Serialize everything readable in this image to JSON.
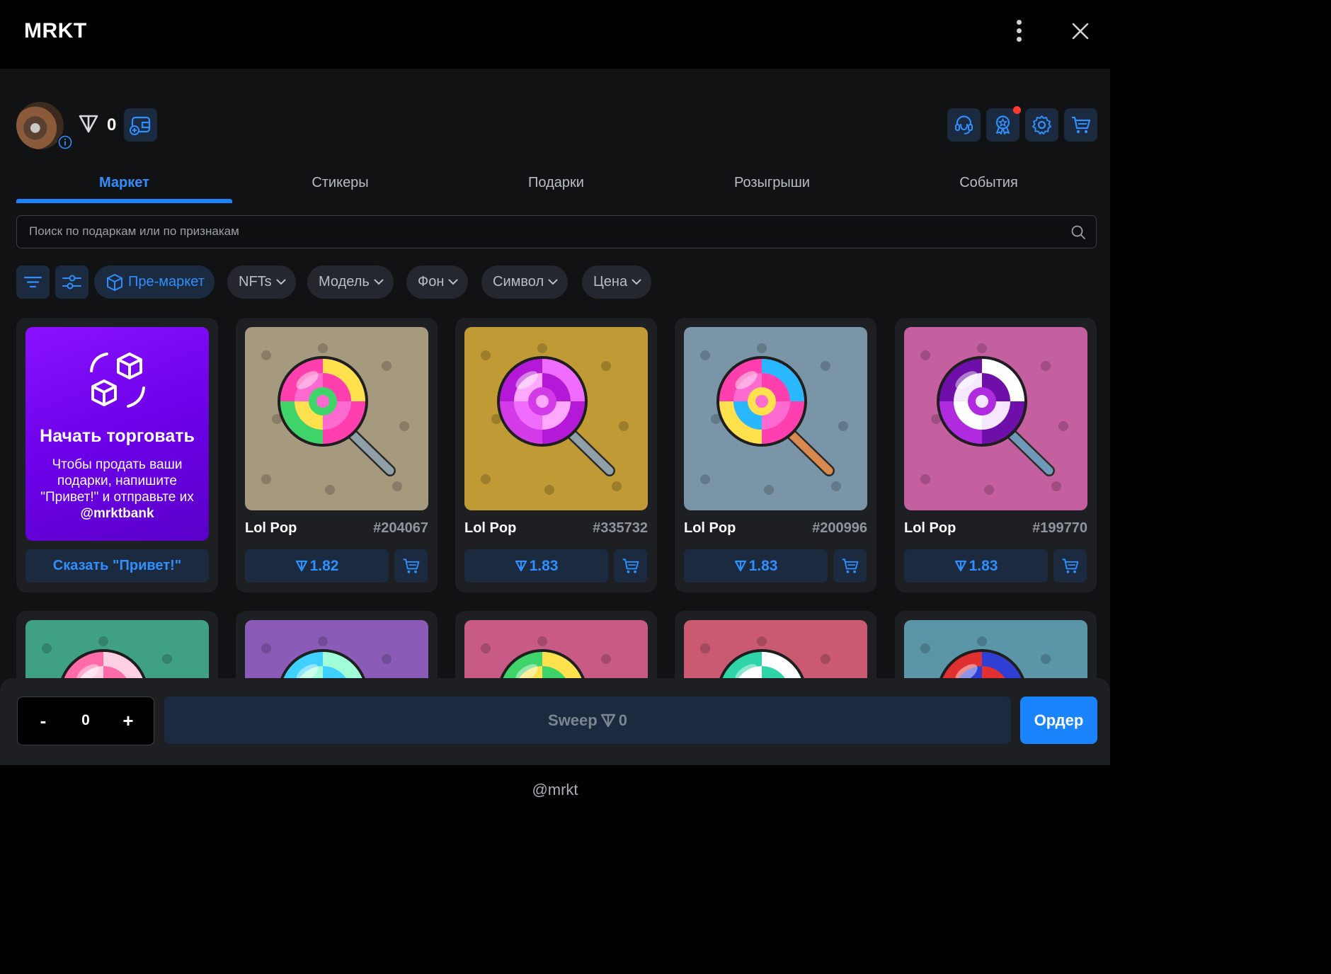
{
  "header": {
    "title": "MRKT",
    "menu_icon": "kebab-icon",
    "close_icon": "close-icon"
  },
  "profile": {
    "balance": "0",
    "currency_icon": "ton-icon"
  },
  "toolbar_icons": [
    "support-icon",
    "rewards-icon",
    "settings-icon",
    "cart-icon"
  ],
  "tabs": [
    {
      "label": "Маркет",
      "active": true
    },
    {
      "label": "Стикеры",
      "active": false
    },
    {
      "label": "Подарки",
      "active": false
    },
    {
      "label": "Розыгрыши",
      "active": false
    },
    {
      "label": "События",
      "active": false
    }
  ],
  "search": {
    "placeholder": "Поиск по подаркам или по признакам",
    "value": ""
  },
  "filters": {
    "premarket": "Пре-маркет",
    "nfts": "NFTs",
    "model": "Модель",
    "background": "Фон",
    "symbol": "Символ",
    "price": "Цена"
  },
  "promo": {
    "title": "Начать торговать",
    "text": "Чтобы продать ваши подарки, напишите \"Привет!\" и отправьте их",
    "handle": "@mrktbank",
    "button": "Сказать \"Привет!\""
  },
  "items": [
    {
      "name": "Lol Pop",
      "number": "#204067",
      "price": "1.82",
      "bg": "#a69a7e",
      "stick": "#8fa0a8",
      "swirl": [
        "#ff3fae",
        "#ffe14d",
        "#3fd46a",
        "#ff6ad0"
      ]
    },
    {
      "name": "Lol Pop",
      "number": "#335732",
      "price": "1.83",
      "bg": "#c09a34",
      "stick": "#8fa0a8",
      "swirl": [
        "#b419d8",
        "#f06cff",
        "#d43be8",
        "#ffa8ff"
      ]
    },
    {
      "name": "Lol Pop",
      "number": "#200996",
      "price": "1.83",
      "bg": "#7a95a8",
      "stick": "#d8894e",
      "swirl": [
        "#ff3fae",
        "#29b7ff",
        "#ffe14d",
        "#ff6ad0"
      ]
    },
    {
      "name": "Lol Pop",
      "number": "#199770",
      "price": "1.83",
      "bg": "#c45fa0",
      "stick": "#6e9ab8",
      "swirl": [
        "#6d0fa8",
        "#ffffff",
        "#b02be0",
        "#f4e7ff"
      ]
    }
  ],
  "row2": [
    {
      "bg": "#3fa083",
      "swirl": [
        "#ff6aa8",
        "#ffd0e4"
      ]
    },
    {
      "bg": "#8a5cb8",
      "swirl": [
        "#3fd0ff",
        "#a0ffd8"
      ]
    },
    {
      "bg": "#c85a86",
      "swirl": [
        "#3fd46a",
        "#ffe14d"
      ]
    },
    {
      "bg": "#c95a72",
      "swirl": [
        "#2fd4a8",
        "#ffffff"
      ]
    },
    {
      "bg": "#5a96a8",
      "swirl": [
        "#e0302f",
        "#2f3fd4"
      ]
    }
  ],
  "bottom": {
    "quantity": "0",
    "minus": "-",
    "plus": "+",
    "sweep_label": "Sweep",
    "sweep_value": "0",
    "order": "Ордер"
  },
  "footer": {
    "handle": "@mrkt"
  },
  "colors": {
    "accent": "#1a84ff",
    "panel": "#111214",
    "card": "#1d1f23",
    "chip": "#1b2a3e"
  }
}
